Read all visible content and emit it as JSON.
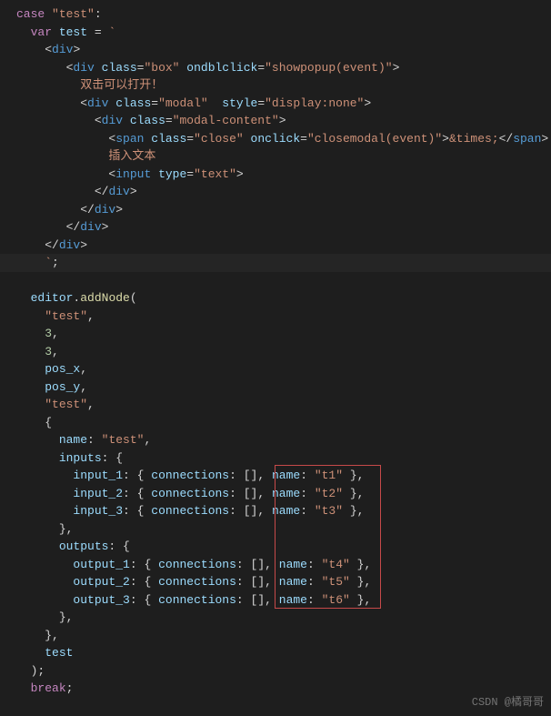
{
  "code": {
    "case_kw": "case",
    "case_label": "\"test\"",
    "var_kw": "var",
    "var_name": "test",
    "template_open": "`",
    "tpl": {
      "div_o": "<div>",
      "box_o": "<div class=\"box\" ondblclick=\"showpopup(event)\">",
      "zh1": "双击可以打开！",
      "modal_o": "<div class=\"modal\"  style=\"display:none\">",
      "modalc_o": "<div class=\"modal-content\">",
      "span_close": "<span class=\"close\" onclick=\"closemodal(event)\">&times;</span>",
      "zh2": "插入文本",
      "input_text": "<input type=\"text\">",
      "div_c": "</div>"
    },
    "template_close": "`;",
    "editor_obj": "editor",
    "addNode_fn": "addNode",
    "args": {
      "a1": "\"test\"",
      "a2": "3",
      "a3": "3",
      "a4": "pos_x",
      "a5": "pos_y",
      "a6": "\"test\""
    },
    "obj": {
      "name_k": "name",
      "name_v": "\"test\"",
      "inputs_k": "inputs",
      "in1_k": "input_1",
      "in1_v": "{ connections: [], name: \"t1\" }",
      "in2_k": "input_2",
      "in2_v": "{ connections: [], name: \"t2\" }",
      "in3_k": "input_3",
      "in3_v": "{ connections: [], name: \"t3\" }",
      "outputs_k": "outputs",
      "out1_k": "output_1",
      "out1_v": "{ connections: [], name: \"t4\" }",
      "out2_k": "output_2",
      "out2_v": "{ connections: [], name: \"t5\" }",
      "out3_k": "output_3",
      "out3_v": "{ connections: [], name: \"t6\" }"
    },
    "trailing_arg": "test",
    "close_call": ");",
    "break_kw": "break"
  },
  "watermark": "CSDN @橘哥哥"
}
